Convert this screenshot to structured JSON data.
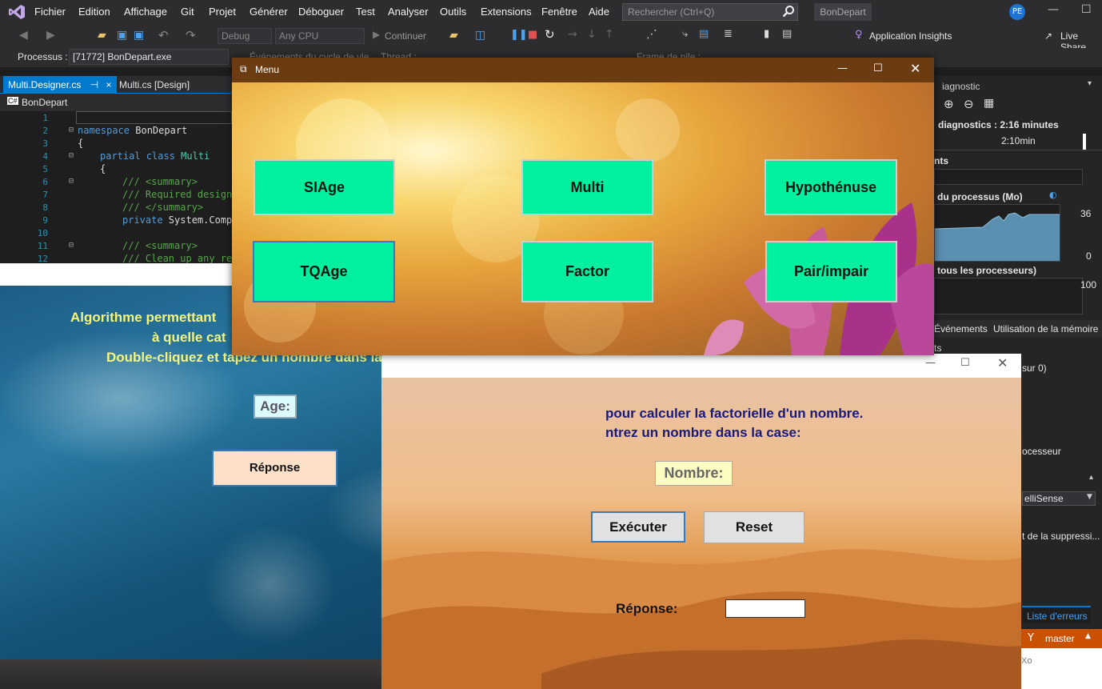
{
  "menubar": {
    "items": [
      "Fichier",
      "Edition",
      "Affichage",
      "Git",
      "Projet",
      "Générer",
      "Déboguer",
      "Test",
      "Analyser",
      "Outils",
      "Extensions",
      "Fenêtre",
      "Aide"
    ],
    "search_placeholder": "Rechercher (Ctrl+Q)",
    "solution": "BonDepart",
    "user_initials": "PE"
  },
  "toolbar": {
    "config": "Debug",
    "platform": "Any CPU",
    "continue": "Continuer",
    "app_insights": "Application Insights",
    "live_share": "Live Share"
  },
  "procbar": {
    "label": "Processus :",
    "process": "[71772] BonDepart.exe",
    "events": "Événements du cycle de vie",
    "thread": "Thread :",
    "frame": "Frame de pile :"
  },
  "tabs": {
    "tab1": "Multi.Designer.cs",
    "pin": "⊣",
    "close": "×",
    "tab2": "Multi.cs [Design]"
  },
  "navbar": {
    "badge": "C#",
    "name": "BonDepart"
  },
  "code": {
    "lines": [
      "1",
      "2",
      "3",
      "4",
      "5",
      "6",
      "7",
      "8",
      "9",
      "10",
      "11",
      "12"
    ],
    "l2_kw": "namespace",
    "l2_name": " BonDepart",
    "l3": "{",
    "l4_kw": "partial class",
    "l4_name": " Multi",
    "l5": "{",
    "l6": "/// <summary>",
    "l7": "/// Required designer",
    "l8": "/// </summary>",
    "l9_kw": "private",
    "l9_rest": " System.Compo",
    "l11": "/// <summary>",
    "l12": "/// Clean up any re"
  },
  "diag": {
    "title": "iagnostic",
    "session": "diagnostics : 2:16 minutes",
    "time": "2:10min",
    "events": "nts",
    "memory": "du processus (Mo)",
    "mem_max": "36",
    "mem_min": "0",
    "cpu": "tous les processeurs)",
    "cpu_max": "100",
    "tab_events": "Événements",
    "tab_mem": "Utilisation de la mémoire",
    "sec": "ts",
    "sur": "sur 0)",
    "processor": "ocesseur",
    "intellisense": "elliSense",
    "suppress": "t de la suppressi...",
    "errors": "Liste d'erreurs",
    "branch": "master",
    "xo": "Xo"
  },
  "menu_window": {
    "title": "Menu",
    "buttons": [
      "SIAge",
      "Multi",
      "Hypothénuse",
      "TQAge",
      "Factor",
      "Pair/impair"
    ]
  },
  "age_window": {
    "line1": "Algorithme permettant",
    "line2": "à quelle cat",
    "line3": "Double-cliquez et tapez un nombre dans la case:",
    "age_label": "Age:",
    "response_button": "Réponse"
  },
  "factor_window": {
    "line1": "pour calculer la factorielle d'un nombre.",
    "line2": "ntrez un nombre dans la case:",
    "number_label": "Nombre:",
    "execute": "Exécuter",
    "reset": "Reset",
    "response_label": "Réponse:",
    "response_value": ""
  },
  "colors": {
    "accent_green": "#00f0a0",
    "menu_title": "#6b3c12",
    "vs_blue": "#007acc"
  }
}
